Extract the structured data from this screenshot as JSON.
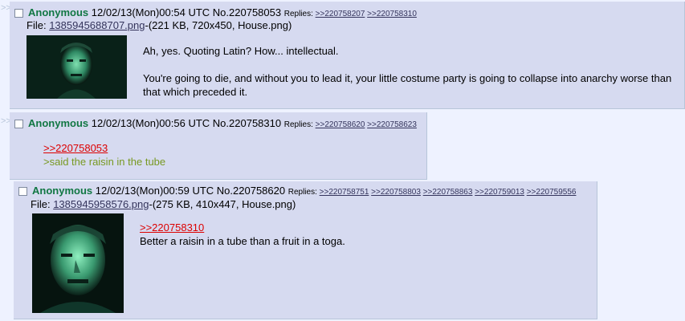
{
  "posts": [
    {
      "name": "Anonymous",
      "date": "12/02/13(Mon)00:54 UTC",
      "no": "No.220758053",
      "replies_label": "Replies:",
      "replies": [
        ">>220758207",
        ">>220758310"
      ],
      "file_label": "File:",
      "file_link": "1385945688707.png",
      "file_info": "-(221 KB, 720x450, House.png)",
      "lines": [
        "Ah, yes. Quoting Latin? How... intellectual.",
        "You're going to die, and without you to lead it, your little costume party is going to collapse into anarchy worse than",
        "that which preceded it."
      ]
    },
    {
      "name": "Anonymous",
      "date": "12/02/13(Mon)00:56 UTC",
      "no": "No.220758310",
      "replies_label": "Replies:",
      "replies": [
        ">>220758620",
        ">>220758623"
      ],
      "quote": ">>220758053",
      "greentext": ">said the raisin in the tube"
    },
    {
      "name": "Anonymous",
      "date": "12/02/13(Mon)00:59 UTC",
      "no": "No.220758620",
      "replies_label": "Replies:",
      "replies": [
        ">>220758751",
        ">>220758803",
        ">>220758863",
        ">>220759013",
        ">>220759556"
      ],
      "file_label": "File:",
      "file_link": "1385945958576.png",
      "file_info": "-(275 KB, 410x447, House.png)",
      "quote": ">>220758310",
      "text": "Better a raisin in a tube than a fruit in a toga."
    }
  ],
  "arrow": ">>",
  "colors": {
    "post_bg": "#d6daf0",
    "name": "#117743",
    "quotelink": "#dd0000",
    "greentext": "#789922",
    "link": "#34345c"
  }
}
